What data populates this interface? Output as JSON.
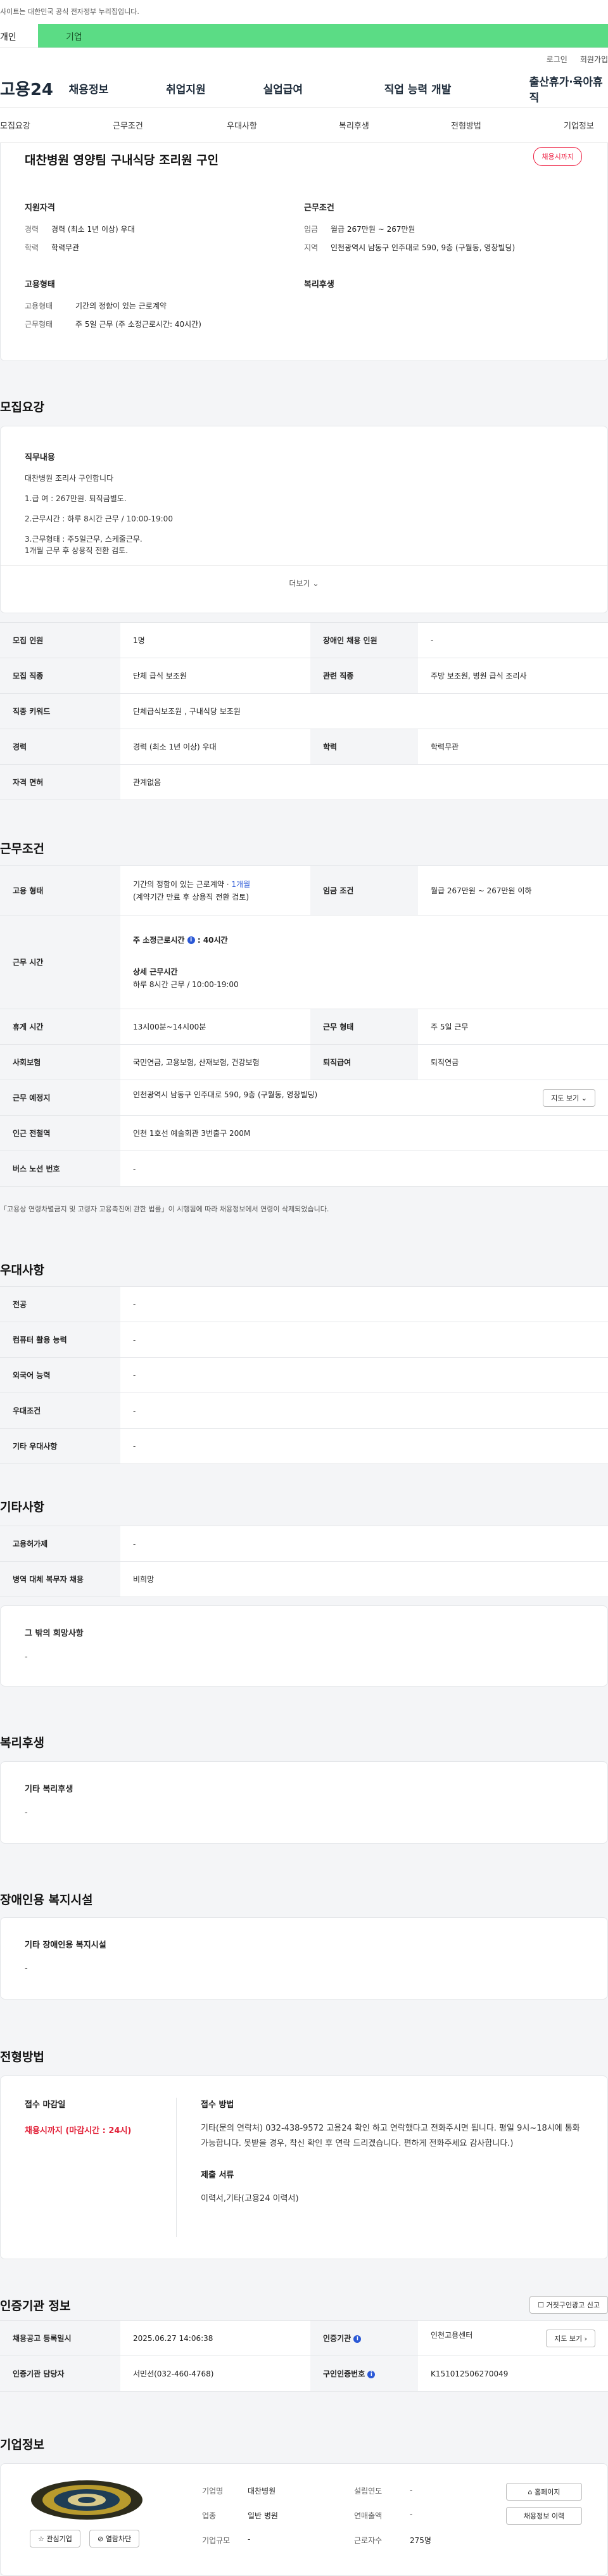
{
  "gov_banner": "사이트는 대한민국 공식 전자정부 누리집입니다.",
  "tabs": {
    "personal": "개인",
    "company": "기업"
  },
  "util": {
    "login": "로그인",
    "join": "회원가입"
  },
  "logo": "고용24",
  "gnb": [
    "채용정보",
    "취업지원",
    "실업급여",
    "직업 능력 개발",
    "출산휴가·육아휴직"
  ],
  "anchor_nav": [
    "모집요강",
    "근무조건",
    "우대사항",
    "복리후생",
    "전형방법",
    "기업정보"
  ],
  "summary": {
    "title": "대찬병원 영양팀 구내식당 조리원 구인",
    "badge": "채용시까지",
    "qual_head": "지원자격",
    "qual": [
      {
        "k": "경력",
        "v": "경력 (최소 1년 이상) 우대"
      },
      {
        "k": "학력",
        "v": "학력무관"
      }
    ],
    "cond_head": "근무조건",
    "cond": [
      {
        "k": "임금",
        "v": "월급 267만원 ~ 267만원"
      },
      {
        "k": "지역",
        "v": "인천광역시 남동구 인주대로 590, 9층 (구월동, 영창빌딩)"
      }
    ],
    "emp_head": "고용형태",
    "emp": [
      {
        "k": "고용형태",
        "v": "기간의 정함이 있는 근로계약"
      },
      {
        "k": "근무형태",
        "v": "주 5일 근무 (주 소정근로시간: 40시간)"
      }
    ],
    "welfare_head": "복리후생"
  },
  "recruit": {
    "title": "모집요강",
    "duty_head": "직무내용",
    "duty_lines": [
      "대찬병원 조리사 구인합니다",
      "1.급 여 : 267만원. 퇴직금별도.",
      "2.근무시간 : 하루 8시간 근무 / 10:00-19:00",
      "3.근무형태 : 주5일근무, 스케줄근무.",
      "1개월 근무 후 상용직 전환 검토."
    ],
    "more": "더보기",
    "rows": [
      {
        "k1": "모집 인원",
        "v1": "1명",
        "k2": "장애인 채용 인원",
        "v2": "-"
      },
      {
        "k1": "모집 직종",
        "v1": "단체 급식 보조원",
        "k2": "관련 직종",
        "v2": "주방 보조원, 병원 급식 조리사"
      },
      {
        "k1": "직종 키워드",
        "v1": "단체급식보조원 , 구내식당 보조원"
      },
      {
        "k1": "경력",
        "v1": "경력 (최소 1년 이상) 우대",
        "k2": "학력",
        "v2": "학력무관"
      },
      {
        "k1": "자격 면허",
        "v1": "관계없음"
      }
    ]
  },
  "work": {
    "title": "근무조건",
    "emp_label": "고용 형태",
    "emp_value": "기간의 정함이 있는 근로계약 ·",
    "emp_period": "1개월",
    "emp_sub": "(계약기간 만료 후 상용직 전환 검토)",
    "wage_label": "임금 조건",
    "wage_value": "월급 267만원 ~ 267만원 이하",
    "time_label": "근무 시간",
    "time_week": "주 소정근로시간",
    "time_week_val": ": 40시간",
    "time_detail_head": "상세 근무시간",
    "time_detail": "하루 8시간 근무 / 10:00-19:00",
    "rest_label": "휴게 시간",
    "rest_value": "13시00분~14시00분",
    "type_label": "근무 형태",
    "type_value": "주 5일 근무",
    "ins_label": "사회보험",
    "ins_value": "국민연금, 고용보험, 산재보험, 건강보험",
    "retire_label": "퇴직급여",
    "retire_value": "퇴직연금",
    "place_label": "근무 예정지",
    "place_value": "인천광역시 남동구 인주대로 590, 9층 (구월동, 영창빌딩)",
    "map_btn": "지도 보기",
    "subway_label": "인근 전철역",
    "subway_value": "인천 1호선 예술회관 3번출구 200M",
    "bus_label": "버스 노선 번호",
    "bus_value": "-",
    "note": "「고용상 연령차별금지 및 고령자 고용촉진에 관한 법률」이 시행됨에 따라 채용정보에서 연령이 삭제되었습니다."
  },
  "pref": {
    "title": "우대사항",
    "rows": [
      {
        "k": "전공",
        "v": "-"
      },
      {
        "k": "컴퓨터 활용 능력",
        "v": "-"
      },
      {
        "k": "외국어 능력",
        "v": "-"
      },
      {
        "k": "우대조건",
        "v": "-"
      },
      {
        "k": "기타 우대사항",
        "v": "-"
      }
    ]
  },
  "etc": {
    "title": "기타사항",
    "rows": [
      {
        "k": "고용허가제",
        "v": "-"
      },
      {
        "k": "병역 대체 복무자 채용",
        "v": "비희망"
      }
    ],
    "wish_head": "그 밖의 희망사항",
    "wish_val": "-"
  },
  "welfare": {
    "title": "복리후생",
    "head": "기타 복리후생",
    "val": "-"
  },
  "disabled": {
    "title": "장애인용 복지시설",
    "head": "기타 장애인용 복지시설",
    "val": "-"
  },
  "screen": {
    "title": "전형방법",
    "deadline_head": "접수 마감일",
    "deadline_val": "채용시까지 (마감시간 : 24시)",
    "method_head": "접수 방법",
    "method_val": "기타(문의 연락처) 032-438-9572 고용24 확인 하고 연락했다고 전화주시면 됩니다. 평일 9시~18시에 통화 가능합니다. 못받을 경우, 착신 확인 후 연락 드리겠습니다. 편하게 전화주세요 감사합니다.)",
    "docs_head": "제출 서류",
    "docs_val": "이력서,기타(고용24 이력서)"
  },
  "agency": {
    "title": "인증기관 정보",
    "report_btn": "거짓구인광고 신고",
    "reg_label": "채용공고 등록일시",
    "reg_val": "2025.06.27 14:06:38",
    "org_label": "인증기관",
    "org_val": "인천고용센터",
    "map_btn": "지도 보기",
    "mgr_label": "인증기관 담당자",
    "mgr_val": "서민선(032-460-4768)",
    "no_label": "구인인증번호",
    "no_val": "K151012506270049"
  },
  "company": {
    "title": "기업정보",
    "name_label": "기업명",
    "name_val": "대찬병원",
    "year_label": "설립연도",
    "year_val": "-",
    "biz_label": "업종",
    "biz_val": "일반 병원",
    "sales_label": "연매출액",
    "sales_val": "-",
    "size_label": "기업규모",
    "size_val": "-",
    "emp_label": "근로자수",
    "emp_val": "275명",
    "fav_btn": "관심기업",
    "block_btn": "열람차단",
    "home_btn": "홈페이지",
    "jobs_btn": "채용정보 이력"
  }
}
